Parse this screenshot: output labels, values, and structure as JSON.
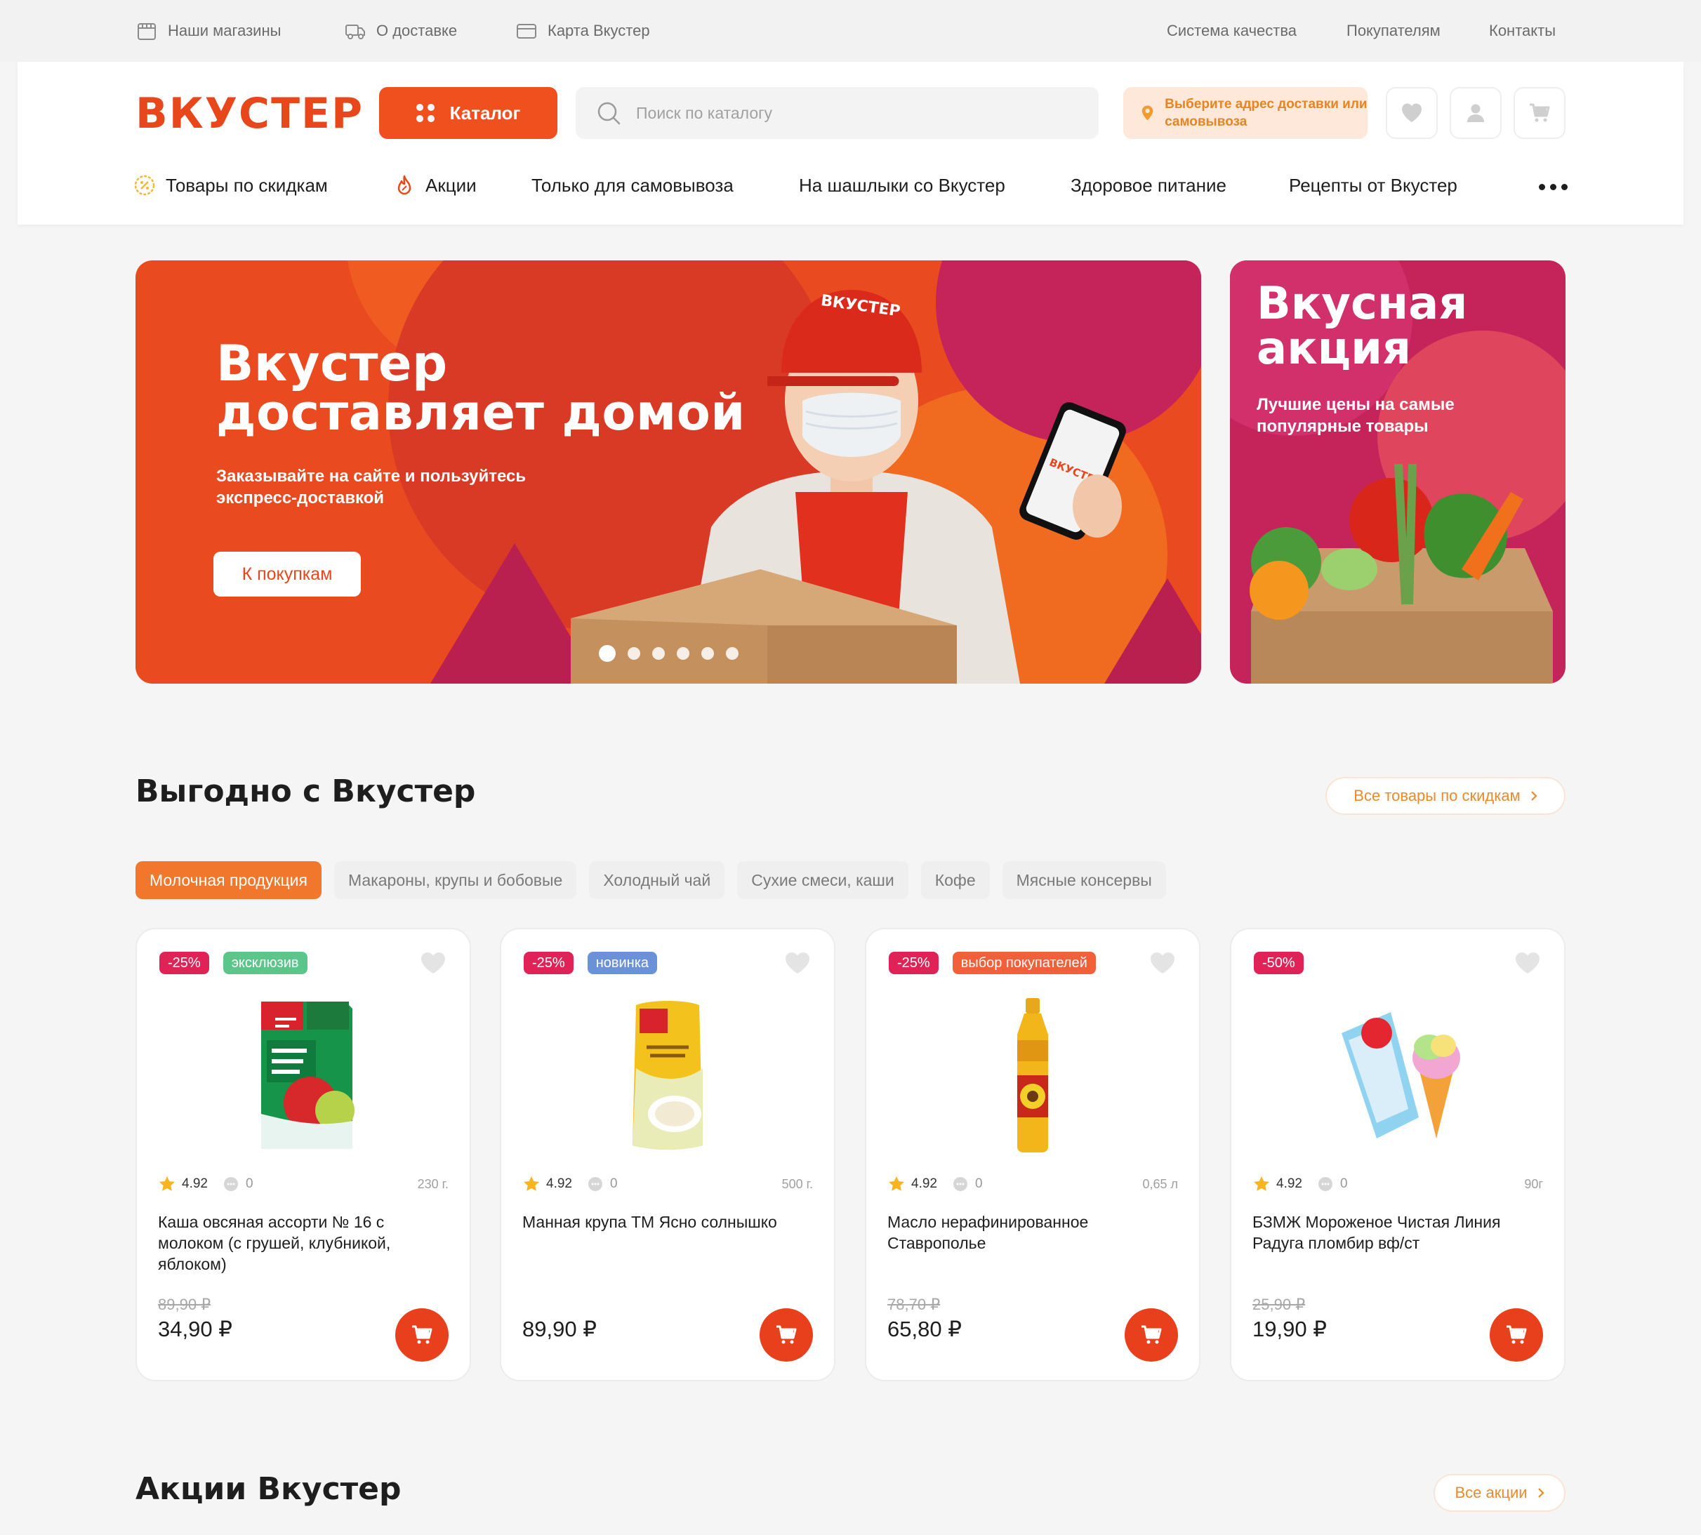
{
  "topbar": {
    "links_left": [
      {
        "label": "Наши магазины",
        "icon": "store-icon"
      },
      {
        "label": "О доставке",
        "icon": "delivery-truck-icon"
      },
      {
        "label": "Карта Вкустер",
        "icon": "card-icon"
      }
    ],
    "links_right": [
      "Система качества",
      "Покупателям",
      "Контакты"
    ]
  },
  "header": {
    "logo_text": "ВКУСТЕР",
    "catalog_label": "Каталог",
    "search_placeholder": "Поиск по каталогу",
    "delivery_label": "Выберите адрес доставки или самовывоза",
    "icons": [
      "heart-icon",
      "user-icon",
      "cart-icon"
    ]
  },
  "nav": {
    "items": [
      {
        "label": "Товары по скидкам",
        "icon": "discount-icon"
      },
      {
        "label": "Акции",
        "icon": "fire-icon"
      },
      {
        "label": "Только для самовывоза"
      },
      {
        "label": "На шашлыки со Вкустер"
      },
      {
        "label": "Здоровое питание"
      },
      {
        "label": "Рецепты от Вкустер"
      }
    ],
    "more_icon": "more-dots-icon"
  },
  "hero": {
    "title": "Вкустер\nдоставляет домой",
    "subtitle": "Заказывайте на сайте и пользуйтесь\nэкспресс-доставкой",
    "button_label": "К покупкам",
    "slides_count": 6,
    "active_slide": 1,
    "cap_text": "ВКУСТЕР",
    "phone_logo_text": "ВКУСТЕР"
  },
  "promo_side": {
    "title": "Вкусная\nакция",
    "subtitle": "Лучшие цены на самые популярные товары"
  },
  "deals": {
    "title": "Выгодно с Вкустер",
    "all_link": "Все товары по скидкам",
    "categories": [
      {
        "label": "Молочная продукция",
        "active": true
      },
      {
        "label": "Макароны, крупы и бобовые",
        "active": false
      },
      {
        "label": "Холодный чай",
        "active": false
      },
      {
        "label": "Сухие смеси, каши",
        "active": false
      },
      {
        "label": "Кофе",
        "active": false
      },
      {
        "label": "Мясные консервы",
        "active": false
      }
    ],
    "products": [
      {
        "discount": "-25%",
        "tag": "эксклюзив",
        "tag_type": "excl",
        "rating": "4.92",
        "comments": "0",
        "weight": "230 г.",
        "name": "Каша овсяная ассорти № 16 с молоком (с грушей, клубникой, яблоком)",
        "old_price": "89,90 ₽",
        "price": "34,90 ₽",
        "image": "oatmeal-box"
      },
      {
        "discount": "-25%",
        "tag": "новинка",
        "tag_type": "new",
        "rating": "4.92",
        "comments": "0",
        "weight": "500 г.",
        "name": "Манная крупа ТМ Ясно солнышко",
        "old_price": "",
        "price": "89,90 ₽",
        "image": "semolina-pack"
      },
      {
        "discount": "-25%",
        "tag": "выбор покупателей",
        "tag_type": "pick",
        "rating": "4.92",
        "comments": "0",
        "weight": "0,65 л",
        "name": "Масло нерафинированное Ставрополье",
        "old_price": "78,70 ₽",
        "price": "65,80 ₽",
        "image": "oil-bottle"
      },
      {
        "discount": "-50%",
        "tag": "",
        "tag_type": "",
        "rating": "4.92",
        "comments": "0",
        "weight": "90г",
        "name": "БЗМЖ Мороженое Чистая Линия Радуга пломбир вф/ст",
        "old_price": "25,90 ₽",
        "price": "19,90 ₽",
        "image": "ice-cream-cone"
      }
    ]
  },
  "promos": {
    "title": "Акции Вкустер",
    "all_link": "Все акции"
  },
  "colors": {
    "brand": "#e8471c",
    "accent_orange": "#f0772c",
    "side_banner": "#c4245a",
    "discount_badge": "#e02356"
  }
}
